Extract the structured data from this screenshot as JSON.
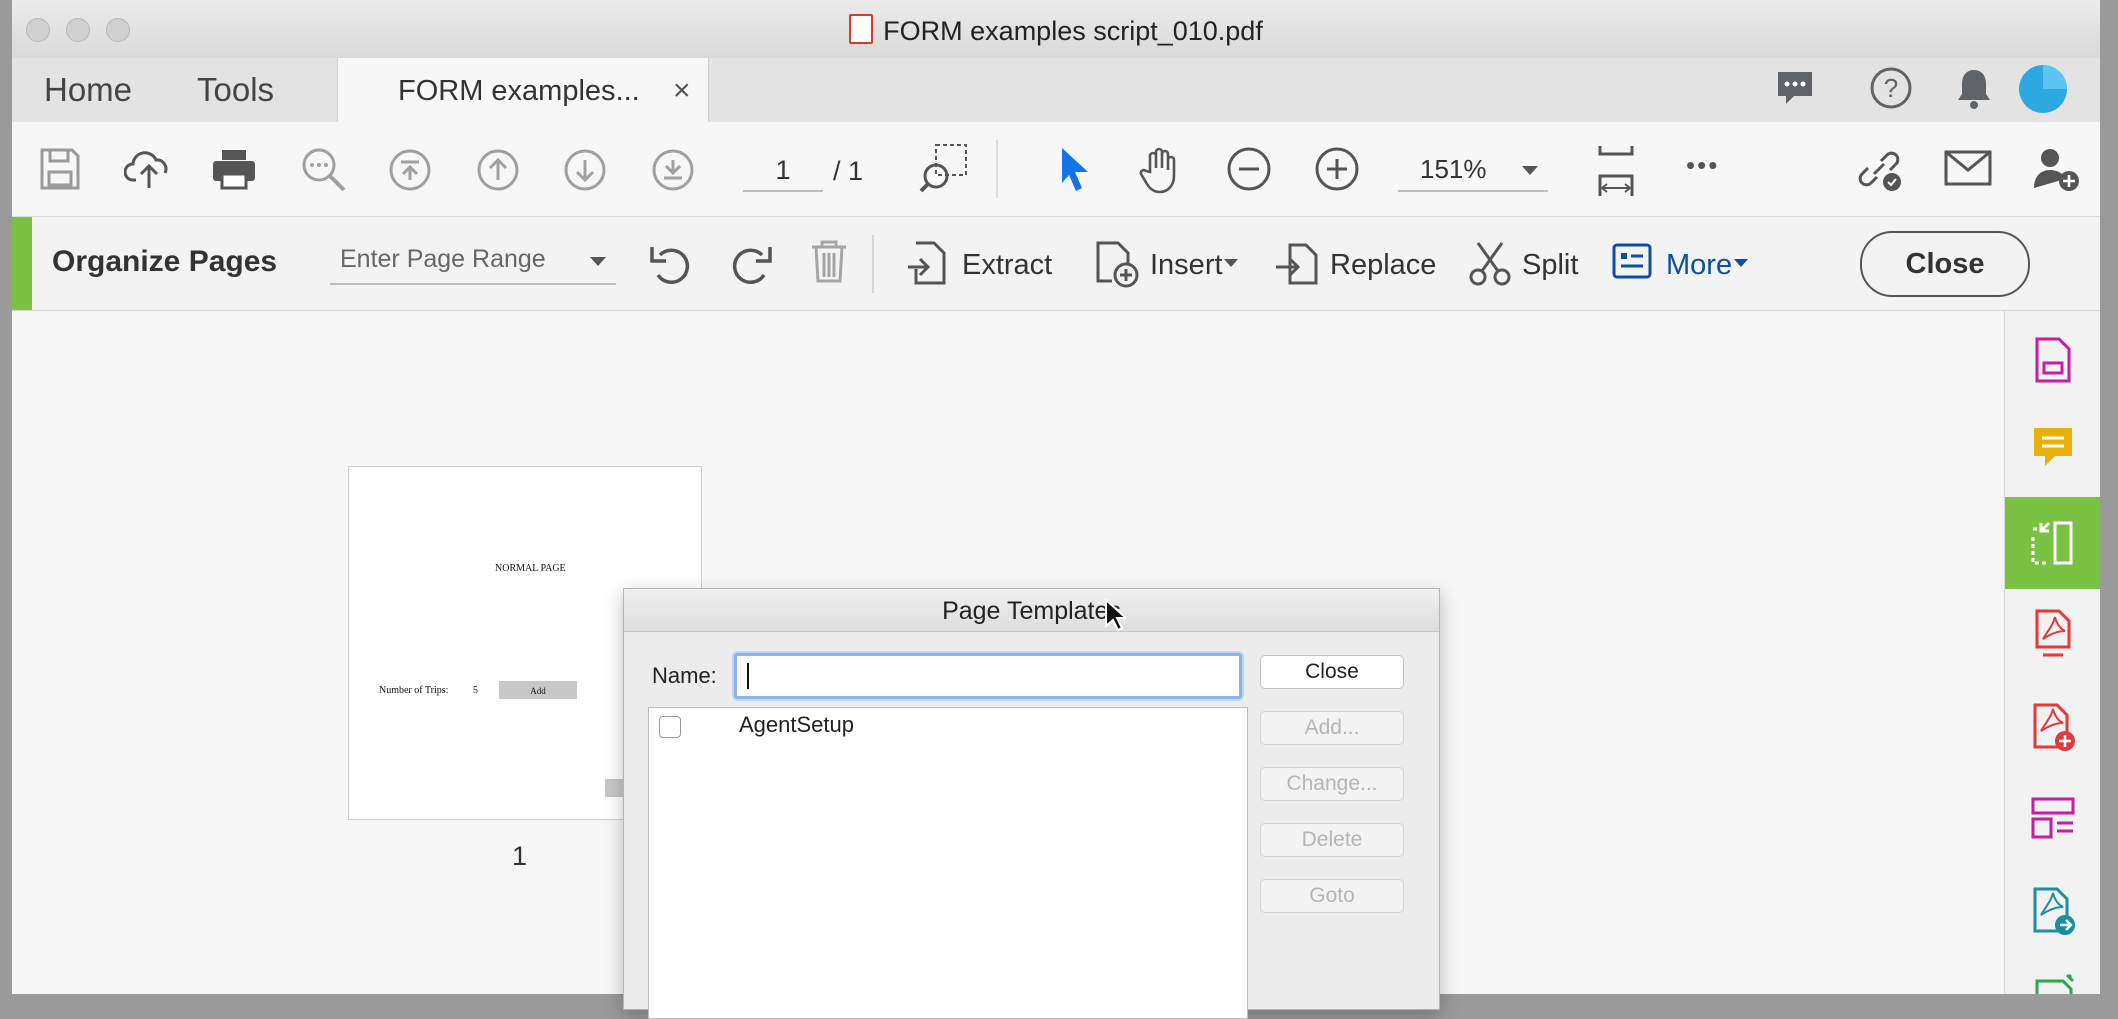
{
  "window": {
    "title": "FORM examples script_010.pdf"
  },
  "tabs": {
    "home": "Home",
    "tools": "Tools",
    "document_tab": "FORM examples...",
    "close_tab": "×"
  },
  "toolbar": {
    "page_current": "1",
    "page_total": "/ 1",
    "zoom": "151%",
    "more": "•••"
  },
  "organize": {
    "title": "Organize Pages",
    "page_range_placeholder": "Enter Page Range",
    "extract": "Extract",
    "insert": "Insert",
    "replace": "Replace",
    "split": "Split",
    "more": "More",
    "close": "Close"
  },
  "thumbnail": {
    "heading": "NORMAL PAGE",
    "field_label": "Number of Trips:",
    "field_value": "5",
    "button": "Add",
    "page_number": "1"
  },
  "dialog": {
    "title": "Page Templates",
    "name_label": "Name:",
    "name_value": "",
    "items": [
      {
        "label": "AgentSetup",
        "checked": false
      }
    ],
    "buttons": {
      "close": "Close",
      "add": "Add...",
      "change": "Change...",
      "delete": "Delete",
      "goto": "Goto"
    }
  },
  "colors": {
    "accent_blue": "#1473e6",
    "organize_green": "#7ac243",
    "brand_dark": "#0b4fa0"
  },
  "icons": [
    "save-icon",
    "upload-icon",
    "print-icon",
    "search-icon",
    "first-page-icon",
    "prev-page-icon",
    "next-page-icon",
    "last-page-icon",
    "marquee-zoom-icon",
    "select-cursor-icon",
    "hand-icon",
    "zoom-out-icon",
    "zoom-in-icon",
    "fit-page-icon",
    "share-link-icon",
    "email-icon",
    "add-user-icon"
  ]
}
